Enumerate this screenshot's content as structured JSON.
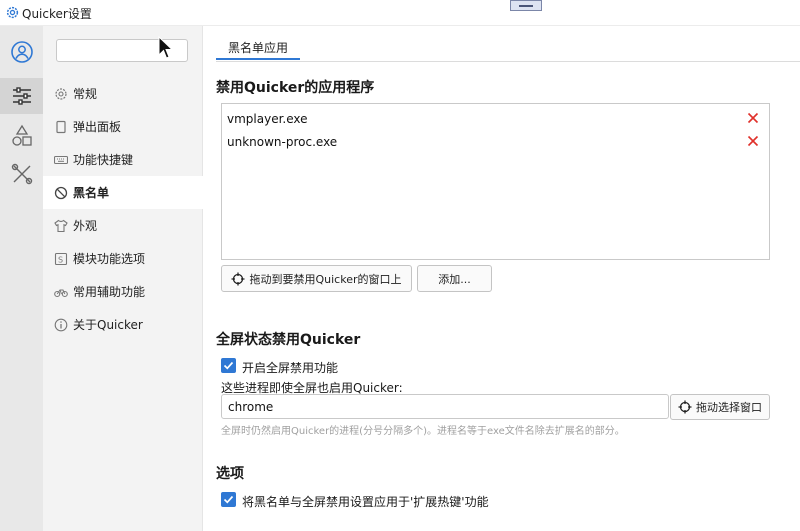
{
  "window": {
    "title": "Quicker设置"
  },
  "sidebar": {
    "search_placeholder": "",
    "items": [
      {
        "label": "常规",
        "icon": "gear-icon",
        "active": false
      },
      {
        "label": "弹出面板",
        "icon": "panel-icon",
        "active": false
      },
      {
        "label": "功能快捷键",
        "icon": "keyboard-icon",
        "active": false
      },
      {
        "label": "黑名单",
        "icon": "ban-icon",
        "active": true
      },
      {
        "label": "外观",
        "icon": "shirt-icon",
        "active": false
      },
      {
        "label": "模块功能选项",
        "icon": "module-icon",
        "active": false
      },
      {
        "label": "常用辅助功能",
        "icon": "bike-icon",
        "active": false
      },
      {
        "label": "关于Quicker",
        "icon": "info-icon",
        "active": false
      }
    ]
  },
  "rail": {
    "items": [
      "user-icon",
      "sliders-icon",
      "shapes-icon",
      "tools-icon"
    ],
    "active_index": 1
  },
  "main": {
    "tab_label": "黑名单应用",
    "section_blocked": {
      "heading": "禁用Quicker的应用程序",
      "apps": [
        "vmplayer.exe",
        "unknown-proc.exe"
      ],
      "drag_button": "拖动到要禁用Quicker的窗口上",
      "add_button": "添加..."
    },
    "section_fullscreen": {
      "heading": "全屏状态禁用Quicker",
      "enable_label": "开启全屏禁用功能",
      "enable_checked": true,
      "exceptions_label": "这些进程即使全屏也启用Quicker:",
      "exceptions_value": "chrome",
      "pick_window_button": "拖动选择窗口",
      "hint": "全屏时仍然启用Quicker的进程(分号分隔多个)。进程名等于exe文件名除去扩展名的部分。"
    },
    "section_options": {
      "heading": "选项",
      "apply_label": "将黑名单与全屏禁用设置应用于'扩展热键'功能",
      "apply_checked": true
    }
  },
  "colors": {
    "accent": "#2f78d4",
    "remove": "#e0302a",
    "rail_bg": "#e8e8e8",
    "sidebar_bg": "#f3f3f3"
  }
}
